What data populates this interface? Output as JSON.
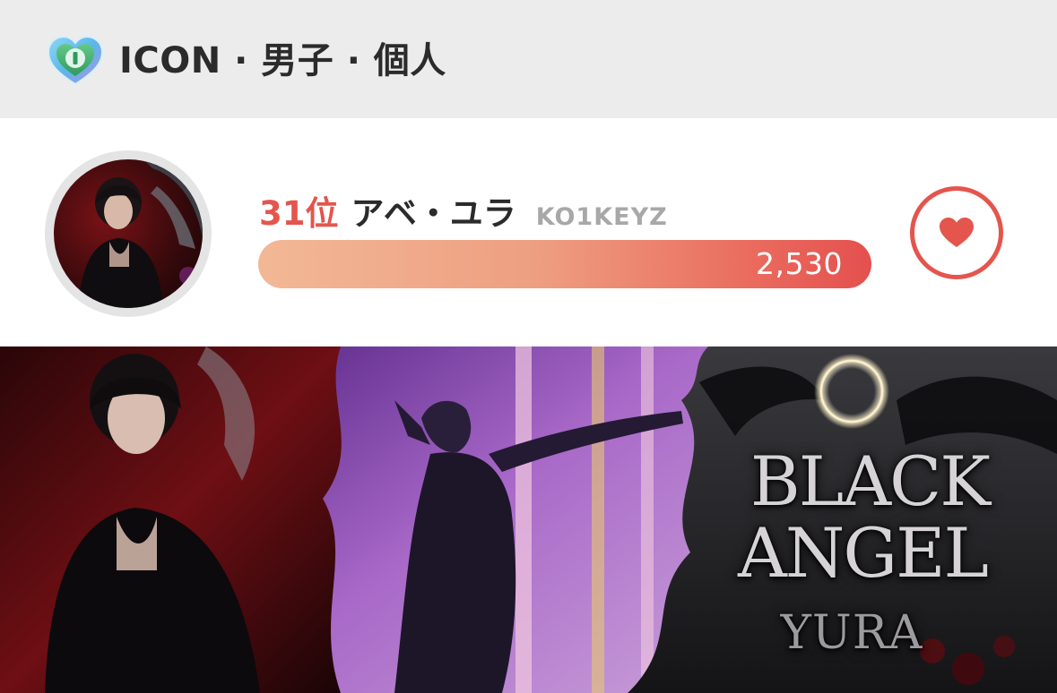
{
  "header": {
    "icon": "icon-heart-badge",
    "title": "ICON · 男子 · 個人"
  },
  "ranking": {
    "avatar": "avatar",
    "rank": "31位",
    "name": "アベ・ユラ",
    "group": "KO1KEYZ",
    "votes": "2,530",
    "vote_bar_fill": 1.0,
    "vote_button_icon": "heart-icon"
  },
  "banner": {
    "line1": "BLACK",
    "line2": "ANGEL",
    "line3": "YURA"
  },
  "colors": {
    "accent": "#e4554d",
    "header_bg": "#ececec",
    "bar_start": "#f2b896",
    "bar_end": "#e4504e"
  }
}
